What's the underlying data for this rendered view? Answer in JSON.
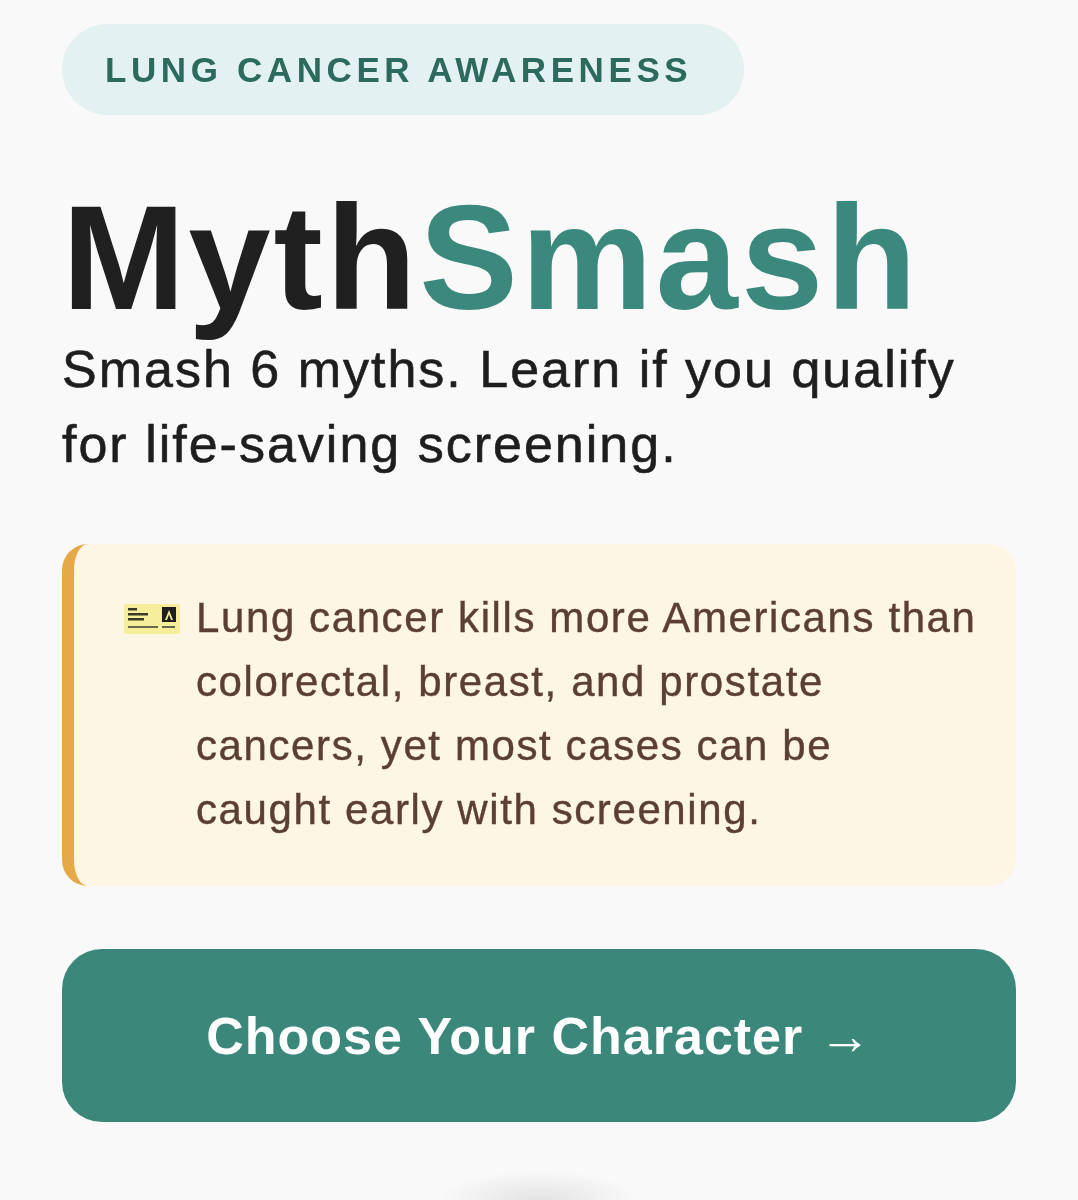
{
  "badge": {
    "label": "LUNG CANCER AWARENESS"
  },
  "title": {
    "parts": [
      {
        "text": "Myth",
        "kind": "plain"
      },
      {
        "text": "Smash",
        "kind": "accent"
      }
    ]
  },
  "subtitle": "Smash 6 myths. Learn if you qualify for life-saving screening.",
  "fact_card": {
    "text": "Lung cancer kills more Americans than colorectal, breast, and prostate cancers, yet most cases can be caught early with screening."
  },
  "primary_button": {
    "label": "Choose Your Character →"
  }
}
